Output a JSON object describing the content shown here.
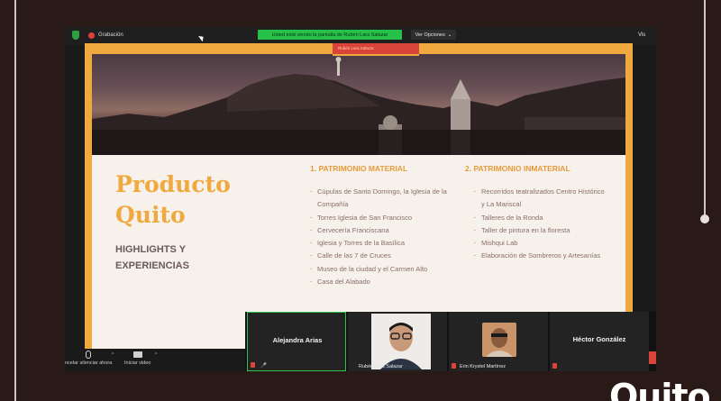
{
  "zoom": {
    "recording_label": "Grabación",
    "share_banner": "Usted está viendo la pantalla de Rubén Lara Salazar",
    "options_label": "Ver Opciones",
    "options_caret": "⌄",
    "view_label": "Vis",
    "toolbar": {
      "mute_label": "ncelar silenciar ahora",
      "video_label": "Iniciar video",
      "caret": "^"
    },
    "participants": [
      {
        "name": "Alejandra Arias",
        "type": "name-only"
      },
      {
        "name": "Rubén Lara Salazar",
        "type": "video"
      },
      {
        "name": "Erin Krystel Martínez",
        "type": "avatar"
      },
      {
        "name": "Héctor González",
        "type": "name-only"
      }
    ]
  },
  "slide": {
    "title_line1": "Producto",
    "title_line2": "Quito",
    "subtitle_line1": "HIGHLIGHTS Y",
    "subtitle_line2": "EXPERIENCIAS",
    "speaker_tab": "Rubén Lara Salazar",
    "col1": {
      "heading": "1. PATRIMONIO MATERIAL",
      "items": [
        "Cúpulas de Santo Domingo, la Iglesia de la Compañía",
        "Torres Iglesia de San Francisco",
        "Cervecería Franciscana",
        "Iglesia y Torres de la Basílica",
        "Calle de las 7 de Cruces",
        "Museo de la ciudad y el Carmen Alto",
        "Casa del Alabado"
      ]
    },
    "col2": {
      "heading": "2. PATRIMONIO INMATERIAL",
      "items": [
        "Recorridos teatralizados Centro Histórico y La Mariscal",
        "Talleres de la Ronda",
        "Taller de pintura en la floresta",
        "Mishqui Lab",
        "Elaboración de Sombreros y Artesanías"
      ]
    }
  },
  "brand": {
    "logo_text": "Quito",
    "colors": {
      "accent": "#f0a93e",
      "background": "#2a1a17",
      "share_green": "#27c14a"
    }
  }
}
